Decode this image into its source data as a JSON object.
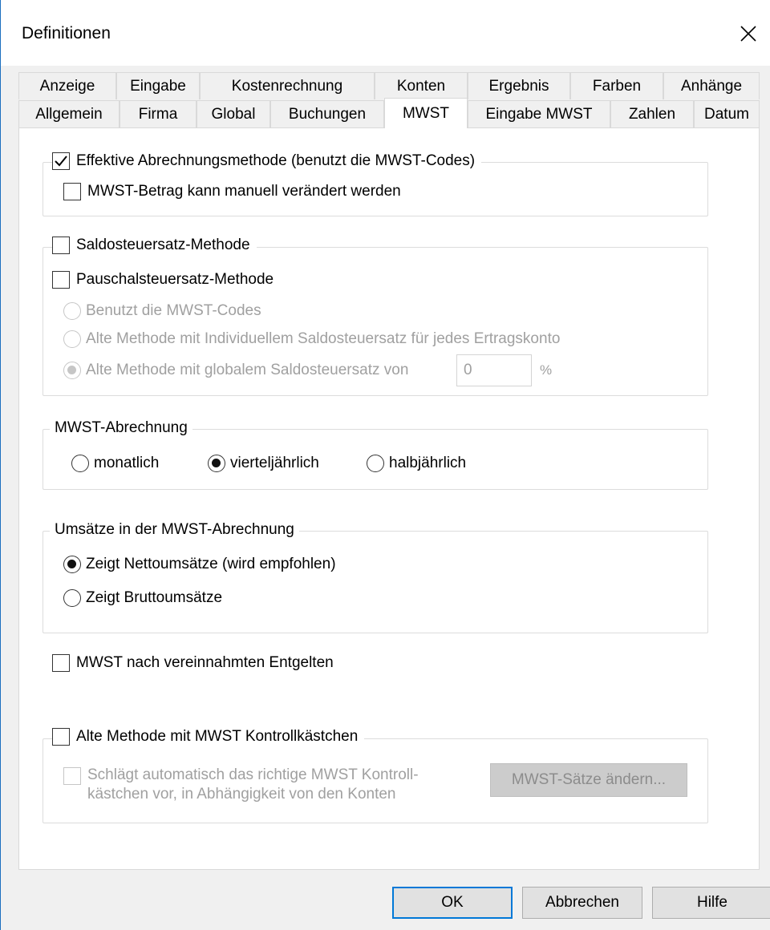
{
  "window": {
    "title": "Definitionen"
  },
  "tabs": {
    "row1": [
      "Anzeige",
      "Eingabe",
      "Kostenrechnung",
      "Konten",
      "Ergebnis",
      "Farben",
      "Anhänge"
    ],
    "row2": [
      "Allgemein",
      "Firma",
      "Global",
      "Buchungen",
      "MWST",
      "Eingabe MWST",
      "Zahlen",
      "Datum"
    ],
    "active": "MWST"
  },
  "effective": {
    "label": "Effektive Abrechnungsmethode (benutzt die MWST-Codes)",
    "checked": true,
    "manual_label": "MWST-Betrag kann manuell verändert werden",
    "manual_checked": false
  },
  "saldo": {
    "label": "Saldosteuersatz-Methode",
    "pauschal_label": "Pauschalsteuersatz-Methode",
    "options": [
      "Benutzt die MWST-Codes",
      "Alte Methode mit Individuellem Saldosteuersatz für jedes Ertragskonto",
      "Alte Methode mit globalem Saldosteuersatz von"
    ],
    "selected_index": 2,
    "rate_value": "0",
    "rate_unit": "%"
  },
  "abrechnung": {
    "legend": "MWST-Abrechnung",
    "options": [
      "monatlich",
      "vierteljährlich",
      "halbjährlich"
    ],
    "selected": "vierteljährlich"
  },
  "umsaetze": {
    "legend": "Umsätze in der MWST-Abrechnung",
    "options": [
      "Zeigt Nettoumsätze (wird empfohlen)",
      "Zeigt Bruttoumsätze"
    ],
    "selected_index": 0
  },
  "vereinnahmt": {
    "label": "MWST nach vereinnahmten Entgelten",
    "checked": false
  },
  "kontroll": {
    "label": "Alte Methode mit MWST Kontrollkästchen",
    "checked": false,
    "auto_line1": "Schlägt automatisch das richtige MWST Kontroll-",
    "auto_line2": "kästchen vor, in Abhängigkeit von den Konten",
    "rates_button": "MWST-Sätze ändern..."
  },
  "buttons": {
    "ok": "OK",
    "cancel": "Abbrechen",
    "help": "Hilfe"
  }
}
